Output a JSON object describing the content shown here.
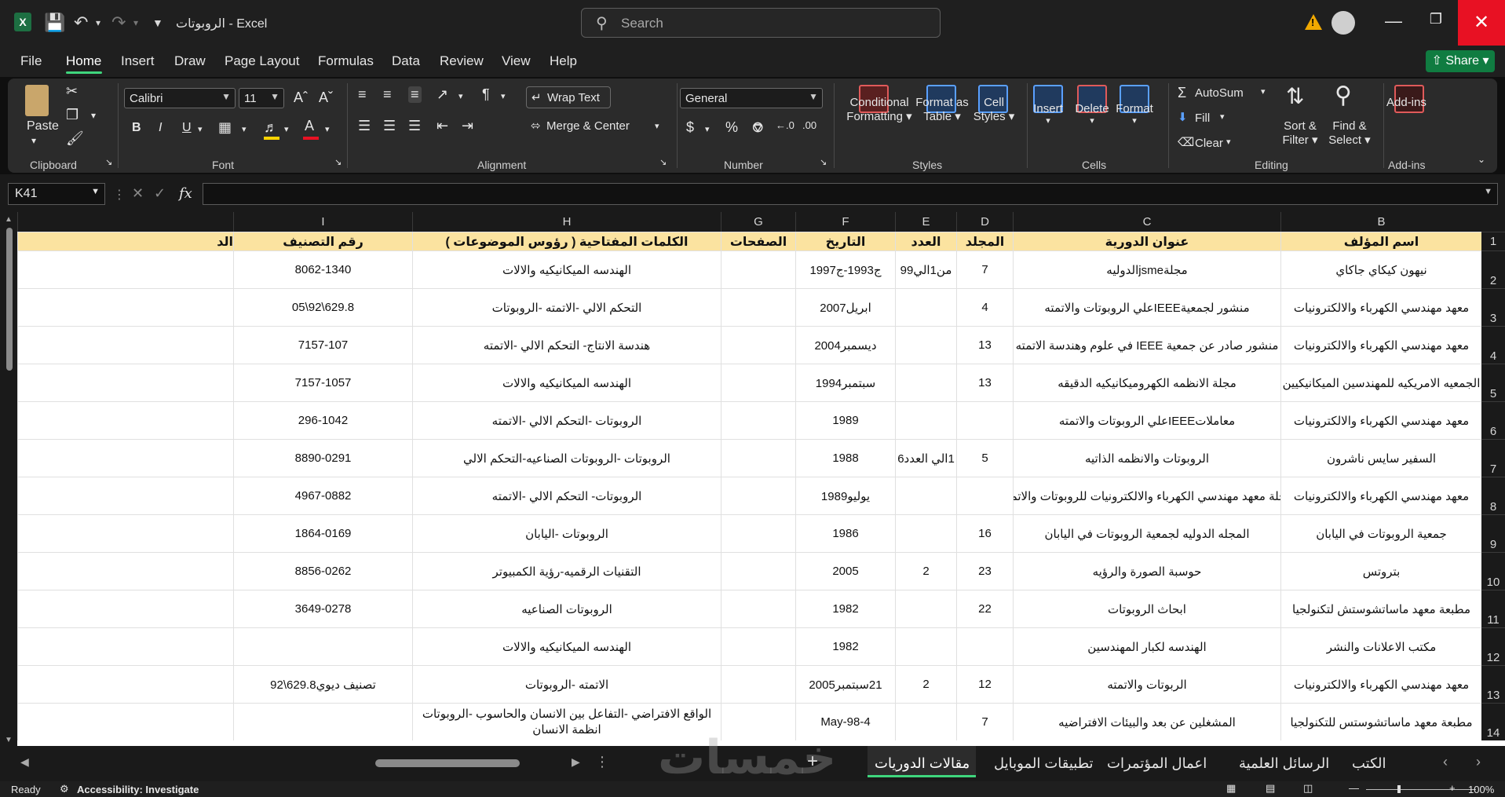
{
  "titlebar": {
    "file_name": "الروبوتات",
    "separator": "-",
    "app_name": "Excel",
    "search_placeholder": "Search"
  },
  "menu": {
    "tabs": [
      "File",
      "Home",
      "Insert",
      "Draw",
      "Page Layout",
      "Formulas",
      "Data",
      "Review",
      "View",
      "Help"
    ],
    "active": "Home",
    "share_label": "Share"
  },
  "ribbon": {
    "clipboard": {
      "paste": "Paste",
      "label": "Clipboard"
    },
    "font": {
      "name": "Calibri",
      "size": "11",
      "label": "Font",
      "bold": "B",
      "italic": "I",
      "underline": "U"
    },
    "alignment": {
      "wrap_text": "Wrap Text",
      "merge_center": "Merge & Center",
      "label": "Alignment"
    },
    "number": {
      "format": "General",
      "label": "Number"
    },
    "styles": {
      "conditional_l1": "Conditional",
      "conditional_l2": "Formatting",
      "format_table_l1": "Format as",
      "format_table_l2": "Table",
      "cell_styles_l1": "Cell",
      "cell_styles_l2": "Styles",
      "label": "Styles"
    },
    "cells": {
      "insert": "Insert",
      "delete": "Delete",
      "format": "Format",
      "label": "Cells"
    },
    "editing": {
      "autosum": "AutoSum",
      "fill": "Fill",
      "clear": "Clear",
      "sort_l1": "Sort &",
      "sort_l2": "Filter",
      "find_l1": "Find &",
      "find_l2": "Select",
      "label": "Editing"
    },
    "addins": {
      "addins": "Add-ins",
      "label": "Add-ins"
    }
  },
  "formula_bar": {
    "name_box": "K41",
    "fx": "fx",
    "formula": ""
  },
  "columns": [
    "B",
    "C",
    "D",
    "E",
    "F",
    "G",
    "H",
    "I"
  ],
  "rows": [
    "1",
    "2",
    "3",
    "4",
    "5",
    "6",
    "7",
    "8",
    "9",
    "10",
    "11",
    "12",
    "13",
    "14"
  ],
  "table": {
    "headers": {
      "B": "اسم المؤلف",
      "C": "عنوان الدورية",
      "D": "المجلد",
      "E": "العدد",
      "F": "التاريخ",
      "G": "الصفحات",
      "H": "الكلمات المفتاحية ( رؤوس الموضوعات )",
      "I": "رقم التصنيف",
      "extra": "الد"
    },
    "data": [
      {
        "B": "نيهون كيكاي جاكاي",
        "C": "مجلةjsmeالدوليه",
        "D": "7",
        "E": "من1الي99",
        "F": "ج1993-ج1997",
        "G": "",
        "H": "الهندسه الميكانيكيه والالات",
        "I": "8062-1340"
      },
      {
        "B": "معهد مهندسي الكهرباء والالكترونيات",
        "C": "منشور لجمعيةIEEEعلي الروبوتات والاتمته",
        "D": "4",
        "E": "",
        "F": "ابريل2007",
        "G": "",
        "H": "التحكم الالي -الاتمته -الروبوتات",
        "I": "629.8\\92\\05"
      },
      {
        "B": "معهد مهندسي الكهرباء والالكترونيات",
        "C": "منشور صادر عن جمعية IEEE في علوم وهندسة الاتمته",
        "D": "13",
        "E": "",
        "F": "ديسمبر2004",
        "G": "",
        "H": "هندسة الانتاج- التحكم الالي -الاتمته",
        "I": "7157-107"
      },
      {
        "B": "الجمعيه الامريكيه للمهندسين الميكانيكيين",
        "C": "مجلة الانظمه الكهروميكانيكيه الدقيقه",
        "D": "13",
        "E": "",
        "F": "سبتمبر1994",
        "G": "",
        "H": "الهندسه الميكانيكيه والالات",
        "I": "7157-1057"
      },
      {
        "B": "معهد مهندسي الكهرباء والالكترونيات",
        "C": "معاملاتIEEEعلي الروبوتات والاتمته",
        "D": "",
        "E": "",
        "F": "1989",
        "G": "",
        "H": "الروبوتات -التحكم الالي -الاتمته",
        "I": "296-1042"
      },
      {
        "B": "السفير سايس ناشرون",
        "C": "الروبوتات والانظمه الذاتيه",
        "D": "5",
        "E": "1الي العدد6",
        "F": "1988",
        "G": "",
        "H": "الروبوتات -الروبوتات الصناعيه-التحكم الالي",
        "I": "8890-0291"
      },
      {
        "B": "معهد مهندسي الكهرباء والالكترونيات",
        "C": "مجلة معهد مهندسي الكهرباء والالكترونيات للروبوتات والاتمته",
        "D": "",
        "E": "",
        "F": "يوليو1989",
        "G": "",
        "H": "الروبوتات- التحكم الالي -الاتمته",
        "I": "4967-0882"
      },
      {
        "B": "جمعية الروبوتات  في اليابان",
        "C": "المجله الدوليه لجمعية الروبوتات في اليابان",
        "D": "16",
        "E": "",
        "F": "1986",
        "G": "",
        "H": "الروبوتات -اليابان",
        "I": "1864-0169"
      },
      {
        "B": "بتروتس",
        "C": "حوسبة الصورة والرؤيه",
        "D": "23",
        "E": "2",
        "F": "2005",
        "G": "",
        "H": "التقنيات الرقميه-رؤية الكمبيوتر",
        "I": "8856-0262"
      },
      {
        "B": "مطبعة معهد ماساتشوستش لتكنولجيا",
        "C": "ابحاث الروبوتات",
        "D": "22",
        "E": "",
        "F": "1982",
        "G": "",
        "H": "الروبوتات الصناعيه",
        "I": "3649-0278"
      },
      {
        "B": "مكتب الاعلانات والنشر",
        "C": "الهندسه لكبار المهندسين",
        "D": "",
        "E": "",
        "F": "1982",
        "G": "",
        "H": "الهندسه الميكانيكيه والالات",
        "I": ""
      },
      {
        "B": "معهد مهندسي الكهرباء والالكترونيات",
        "C": "الربوتات والاتمته",
        "D": "12",
        "E": "2",
        "F": "21سبتمبر2005",
        "G": "",
        "H": "الاتمته -الروبوتات",
        "I": "تصنيف ديوي629.8\\92"
      },
      {
        "B": "مطبعة معهد ماساتشوستس للتكنولجيا",
        "C": "المشغلين عن بعد والبيئات الافتراضيه",
        "D": "7",
        "E": "",
        "F": "4-May-98",
        "G": "",
        "H": "الواقع الافتراضي -التفاعل بين الانسان والحاسوب  -الروبوتات انظمة الانسان",
        "I": ""
      }
    ]
  },
  "sheet_tabs": [
    "مقالات الدوريات",
    "تطبيقات الموبايل",
    "اعمال المؤتمرات",
    "الرسائل العلمية",
    "الكتب"
  ],
  "active_sheet": "مقالات الدوريات",
  "status": {
    "ready": "Ready",
    "accessibility": "Accessibility: Investigate",
    "zoom": "100%"
  },
  "watermark": "خمسات",
  "colors": {
    "header_fill": "#fbe3a0",
    "accent": "#3fd67d",
    "close": "#e81123",
    "share": "#107c41"
  }
}
